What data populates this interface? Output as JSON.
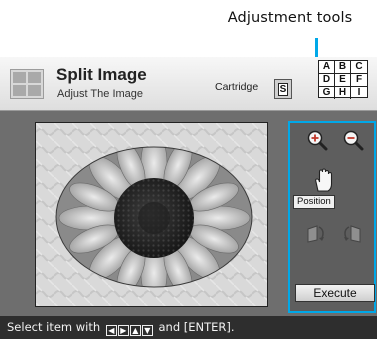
{
  "callout": {
    "label": "Adjustment tools"
  },
  "header": {
    "title": "Split Image",
    "subtitle": "Adjust The Image",
    "cartridge_label": "Cartridge",
    "cartridge_size": "S",
    "grid_letters": [
      "A",
      "B",
      "C",
      "D",
      "E",
      "F",
      "G",
      "H",
      "I"
    ]
  },
  "tools": {
    "zoom_in_icon": "zoom-in-magnifier",
    "zoom_out_icon": "zoom-out-magnifier",
    "position_icon": "hand-pointer",
    "position_label": "Position",
    "rotate_left_icon": "rotate-left-arrow",
    "rotate_right_icon": "rotate-right-arrow",
    "execute_label": "Execute"
  },
  "status": {
    "prefix": "Select item with",
    "arrow_keys": [
      "◀",
      "▶",
      "▲",
      "▼"
    ],
    "suffix": "and [ENTER]."
  },
  "colors": {
    "callout_accent": "#00a8e8",
    "screen_background": "#6e6e6e",
    "status_bar": "#2e2e2e"
  }
}
